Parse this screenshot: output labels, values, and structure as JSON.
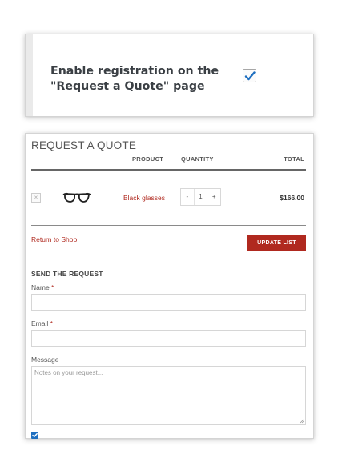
{
  "setting": {
    "label_line1": "Enable registration on the",
    "label_line2": "\"Request a Quote\" page",
    "checked": true
  },
  "quote": {
    "title": "REQUEST A QUOTE",
    "columns": {
      "product": "PRODUCT",
      "quantity": "QUANTITY",
      "total": "TOTAL"
    },
    "items": [
      {
        "remove": "×",
        "product_name": "Black glasses",
        "image_icon": "glasses-icon",
        "qty_minus": "-",
        "quantity": "1",
        "qty_plus": "+",
        "total": "$166.00"
      }
    ],
    "return_link": "Return to Shop",
    "update_button": "UPDATE LIST",
    "send_title": "SEND THE REQUEST",
    "form": {
      "name_label": "Name",
      "email_label": "Email",
      "required_mark": "*",
      "message_label": "Message",
      "message_placeholder": "Notes on your request..."
    },
    "bottom_checkbox_checked": true
  },
  "colors": {
    "accent": "#b0291f",
    "check_blue": "#1e6fc0"
  }
}
